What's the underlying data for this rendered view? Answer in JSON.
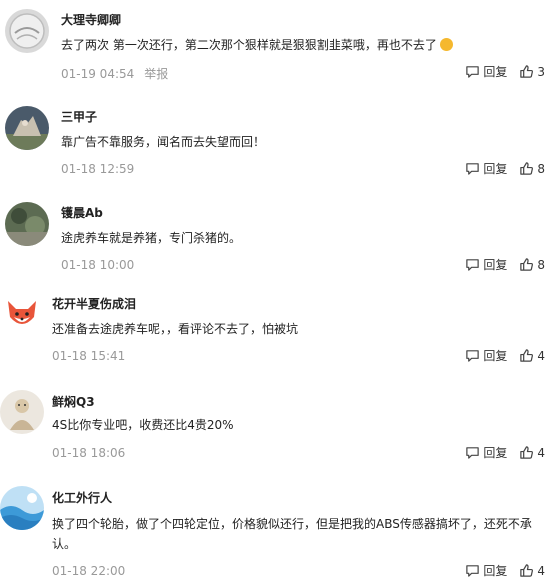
{
  "actions": {
    "reply_label": "回复"
  },
  "comments": [
    {
      "user": "大理寺卿卿",
      "text": "去了两次 第一次还行，第二次那个狠样就是狠狠割韭菜哦，再也不去了",
      "time": "01-19 04:54",
      "report": "举报",
      "likes": "3"
    },
    {
      "user": "三甲子",
      "text": "靠广告不靠服务，闻名而去失望而回！",
      "time": "01-18 12:59",
      "likes": "8"
    },
    {
      "user": "镬晨Ab",
      "text": "途虎养车就是养猪，专门杀猪的。",
      "time": "01-18 10:00",
      "likes": "8"
    },
    {
      "user": "花开半夏伤成泪",
      "text": "还准备去途虎养车呢，，看评论不去了，怕被坑",
      "time": "01-18 15:41",
      "likes": "4"
    },
    {
      "user": "鲜焖Q3",
      "text": "4S比你专业吧，收费还比4贵20%",
      "time": "01-18 18:06",
      "likes": "4"
    },
    {
      "user": "化工外行人",
      "text": "换了四个轮胎，做了个四轮定位，价格貌似还行，但是把我的ABS传感器搞坏了，还死不承认。",
      "time": "01-18 22:00",
      "likes": "4"
    }
  ]
}
